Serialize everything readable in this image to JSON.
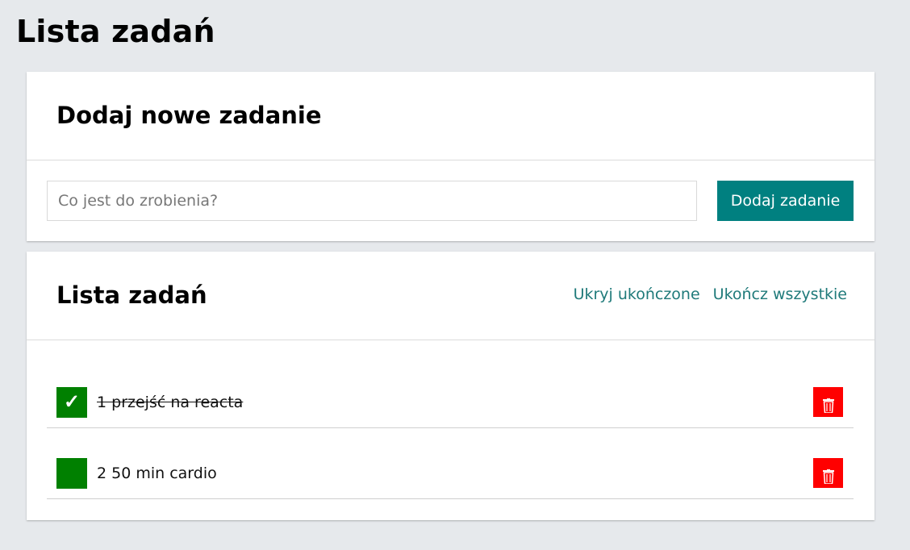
{
  "page": {
    "title": "Lista zadań"
  },
  "add_panel": {
    "title": "Dodaj nowe zadanie",
    "input_placeholder": "Co jest do zrobienia?",
    "input_value": "",
    "button_label": "Dodaj zadanie"
  },
  "list_panel": {
    "title": "Lista zadań",
    "hide_done_label": "Ukryj ukończone",
    "complete_all_label": "Ukończ wszystkie",
    "tasks": [
      {
        "text": "1 przejść na reacta",
        "done": true,
        "check_glyph": "✓"
      },
      {
        "text": "2 50 min cardio",
        "done": false,
        "check_glyph": ""
      }
    ]
  },
  "icons": {
    "check": "checkmark-icon",
    "delete": "trash-icon"
  },
  "colors": {
    "background": "#e6e9ec",
    "accent": "#008080",
    "checkbox": "#008000",
    "delete": "#ff0000",
    "link": "#1f7a7a"
  }
}
